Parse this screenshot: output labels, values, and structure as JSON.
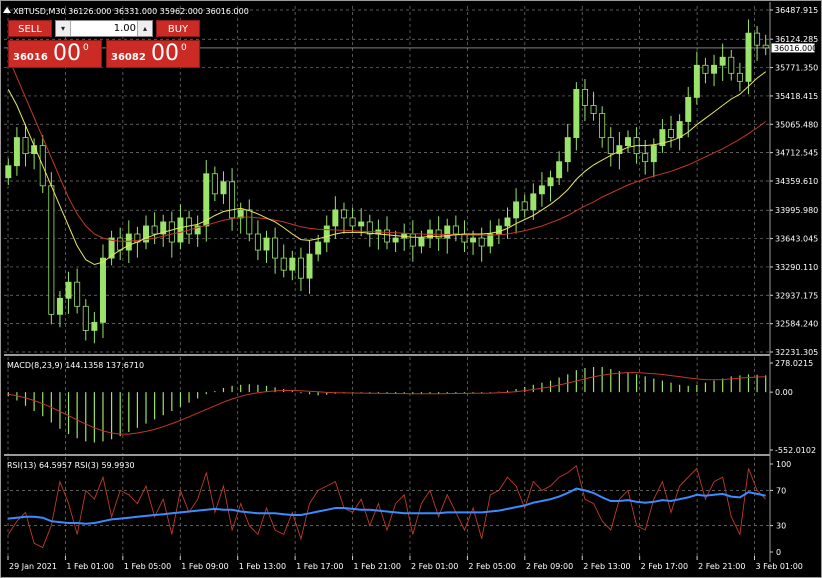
{
  "window": {
    "symbol_line": "XBTUSD,M30  36126.000 36331.000 35962.000 36016.000"
  },
  "trade_panel": {
    "sell_label": "SELL",
    "buy_label": "BUY",
    "lot_value": "1.00",
    "sell_small": "36016",
    "sell_big": "00",
    "sell_sup": "0",
    "buy_small": "36082",
    "buy_big": "00",
    "buy_sup": "0"
  },
  "colors": {
    "background": "#000000",
    "grid": "#7a7a7a",
    "bull_candle": "#9be36a",
    "bear_candle": "#000000",
    "candle_wick": "#9be36a",
    "ma_fast": "#e8e85a",
    "ma_slow": "#c0392b",
    "macd_hist": "#9be36a",
    "macd_signal": "#c0392b",
    "rsi_main": "#3a8cff",
    "rsi_signal": "#c0392b",
    "text": "#ffffff"
  },
  "chart_data": [
    {
      "type": "candlestick",
      "title": "XBTUSD,M30  36126.000 36331.000 35962.000 36016.000",
      "ylim": [
        32231.305,
        36487.915
      ],
      "y_ticks": [
        "36487.915",
        "36124.285",
        "35771.350",
        "35418.415",
        "35065.480",
        "34712.545",
        "34359.610",
        "33995.980",
        "33643.045",
        "33290.110",
        "32937.175",
        "32584.240",
        "32231.305"
      ],
      "current_price_label": "36016.000",
      "current_price": 36016.0,
      "x_tick_labels": [
        "29 Jan 2021",
        "1 Feb 01:00",
        "1 Feb 05:00",
        "1 Feb 09:00",
        "1 Feb 13:00",
        "1 Feb 17:00",
        "1 Feb 21:00",
        "2 Feb 01:00",
        "2 Feb 05:00",
        "2 Feb 09:00",
        "2 Feb 13:00",
        "2 Feb 17:00",
        "2 Feb 21:00",
        "3 Feb 01:00"
      ],
      "close": [
        34550,
        34900,
        34700,
        34800,
        34300,
        32700,
        32900,
        33100,
        32800,
        32500,
        32600,
        33400,
        33650,
        33500,
        33700,
        33600,
        33800,
        33700,
        33850,
        33600,
        33900,
        33700,
        33800,
        34450,
        34200,
        34350,
        33900,
        34000,
        33700,
        33500,
        33650,
        33400,
        33250,
        33400,
        33150,
        33450,
        33600,
        33800,
        34000,
        33900,
        33800,
        33850,
        33700,
        33750,
        33600,
        33650,
        33700,
        33550,
        33650,
        33750,
        33650,
        33800,
        33700,
        33600,
        33650,
        33550,
        33700,
        33800,
        33900,
        34100,
        34000,
        34200,
        34300,
        34400,
        34600,
        34900,
        35500,
        35300,
        35200,
        34900,
        34700,
        34800,
        34900,
        34700,
        34600,
        34800,
        35000,
        34900,
        35100,
        35400,
        35800,
        35700,
        35800,
        35900,
        35700,
        35600,
        36200,
        36050,
        36016
      ],
      "ma_fast": [
        35500,
        35300,
        35050,
        34800,
        34550,
        34300,
        34050,
        33800,
        33550,
        33380,
        33320,
        33350,
        33430,
        33500,
        33560,
        33600,
        33650,
        33690,
        33720,
        33750,
        33780,
        33800,
        33820,
        33870,
        33930,
        33980,
        34000,
        34020,
        33990,
        33950,
        33900,
        33850,
        33780,
        33700,
        33630,
        33620,
        33640,
        33670,
        33700,
        33720,
        33720,
        33720,
        33710,
        33700,
        33690,
        33680,
        33670,
        33660,
        33660,
        33670,
        33670,
        33680,
        33690,
        33700,
        33700,
        33700,
        33710,
        33730,
        33770,
        33830,
        33880,
        33930,
        34000,
        34070,
        34150,
        34250,
        34380,
        34480,
        34560,
        34620,
        34680,
        34730,
        34780,
        34800,
        34800,
        34810,
        34830,
        34860,
        34900,
        34970,
        35060,
        35140,
        35220,
        35300,
        35380,
        35440,
        35540,
        35640,
        35720
      ],
      "ma_slow": [
        35900,
        35650,
        35400,
        35150,
        34900,
        34650,
        34400,
        34150,
        33950,
        33800,
        33700,
        33650,
        33620,
        33610,
        33610,
        33620,
        33630,
        33650,
        33670,
        33700,
        33720,
        33750,
        33780,
        33810,
        33840,
        33870,
        33890,
        33910,
        33910,
        33900,
        33890,
        33870,
        33850,
        33820,
        33790,
        33770,
        33760,
        33755,
        33750,
        33745,
        33740,
        33735,
        33730,
        33725,
        33720,
        33715,
        33710,
        33705,
        33700,
        33698,
        33696,
        33694,
        33692,
        33690,
        33688,
        33686,
        33686,
        33690,
        33700,
        33720,
        33740,
        33770,
        33800,
        33840,
        33880,
        33930,
        33990,
        34050,
        34100,
        34160,
        34210,
        34260,
        34310,
        34350,
        34390,
        34420,
        34450,
        34480,
        34520,
        34560,
        34610,
        34660,
        34710,
        34760,
        34820,
        34880,
        34950,
        35020,
        35100
      ],
      "series": [
        {
          "name": "",
          "values": []
        }
      ]
    },
    {
      "type": "bar",
      "title": "MACD(8,23,9) 144.1358 137.6710",
      "ylim": [
        -552.0102,
        278.0215
      ],
      "y_ticks": [
        "278.0215",
        "0.00",
        "-552.0102"
      ],
      "hist": [
        -40,
        -80,
        -130,
        -180,
        -230,
        -290,
        -350,
        -400,
        -440,
        -470,
        -480,
        -470,
        -450,
        -420,
        -380,
        -340,
        -300,
        -260,
        -220,
        -180,
        -140,
        -100,
        -60,
        -20,
        10,
        40,
        60,
        70,
        75,
        70,
        60,
        45,
        30,
        10,
        -10,
        -20,
        -30,
        -25,
        -15,
        -10,
        -5,
        -5,
        -10,
        -10,
        -15,
        -15,
        -15,
        -20,
        -20,
        -15,
        -15,
        -10,
        -10,
        -10,
        -10,
        -10,
        -5,
        5,
        15,
        30,
        50,
        70,
        90,
        110,
        140,
        170,
        210,
        230,
        240,
        240,
        220,
        200,
        190,
        170,
        150,
        130,
        110,
        90,
        70,
        60,
        70,
        90,
        110,
        130,
        150,
        160,
        170,
        165,
        160
      ],
      "signal": [
        -20,
        -35,
        -55,
        -80,
        -110,
        -145,
        -185,
        -225,
        -265,
        -305,
        -340,
        -370,
        -390,
        -400,
        -400,
        -390,
        -375,
        -355,
        -330,
        -300,
        -270,
        -235,
        -200,
        -165,
        -130,
        -95,
        -65,
        -40,
        -20,
        -5,
        5,
        12,
        16,
        16,
        13,
        8,
        3,
        -2,
        -5,
        -7,
        -8,
        -9,
        -10,
        -11,
        -12,
        -13,
        -14,
        -15,
        -16,
        -16,
        -15,
        -14,
        -13,
        -12,
        -11,
        -10,
        -9,
        -6,
        -2,
        5,
        15,
        25,
        38,
        52,
        68,
        86,
        106,
        126,
        146,
        162,
        174,
        182,
        186,
        186,
        182,
        176,
        168,
        158,
        148,
        136,
        126,
        120,
        118,
        120,
        126,
        134,
        140,
        144,
        146
      ]
    },
    {
      "type": "line",
      "title": "RSI(13) 64.5957  RSI(3) 59.9930",
      "ylim": [
        0,
        100
      ],
      "y_ticks": [
        "100",
        "70",
        "30",
        "0"
      ],
      "series": [
        {
          "name": "",
          "values": [
            38,
            39,
            40,
            40,
            39,
            35,
            34,
            33,
            33,
            32,
            33,
            35,
            37,
            38,
            39,
            40,
            41,
            42,
            43,
            44,
            45,
            46,
            47,
            48,
            49,
            48,
            48,
            46,
            45,
            44,
            44,
            44,
            43,
            42,
            42,
            44,
            46,
            48,
            50,
            50,
            49,
            48,
            48,
            47,
            46,
            45,
            44,
            44,
            44,
            44,
            44,
            45,
            45,
            45,
            45,
            45,
            46,
            47,
            49,
            51,
            53,
            56,
            58,
            60,
            63,
            67,
            72,
            70,
            67,
            62,
            58,
            58,
            59,
            57,
            56,
            57,
            59,
            58,
            60,
            62,
            65,
            64,
            65,
            66,
            63,
            62,
            68,
            66,
            64
          ]
        },
        {
          "name": "",
          "values": [
            20,
            35,
            45,
            10,
            5,
            30,
            80,
            55,
            20,
            70,
            60,
            85,
            40,
            70,
            65,
            55,
            75,
            40,
            60,
            20,
            70,
            45,
            60,
            90,
            45,
            75,
            25,
            55,
            30,
            20,
            50,
            25,
            20,
            45,
            15,
            55,
            70,
            75,
            80,
            50,
            45,
            60,
            30,
            55,
            25,
            55,
            65,
            20,
            55,
            70,
            40,
            65,
            45,
            25,
            50,
            15,
            65,
            70,
            85,
            75,
            50,
            80,
            70,
            75,
            85,
            90,
            98,
            60,
            55,
            35,
            25,
            60,
            70,
            30,
            25,
            60,
            80,
            45,
            75,
            85,
            95,
            60,
            80,
            85,
            40,
            20,
            95,
            70,
            60
          ]
        }
      ]
    }
  ]
}
